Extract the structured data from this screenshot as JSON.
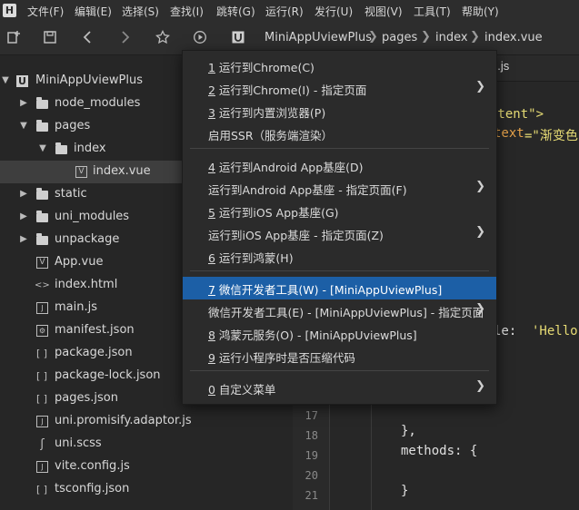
{
  "menubar": {
    "items": [
      "文件(F)",
      "编辑(E)",
      "选择(S)",
      "查找(I)",
      "跳转(G)",
      "运行(R)",
      "发行(U)",
      "视图(V)",
      "工具(T)",
      "帮助(Y)"
    ]
  },
  "breadcrumb": [
    "MiniAppUviewPlus",
    "pages",
    "index",
    "index.vue"
  ],
  "sidebar": {
    "root": "MiniAppUviewPlus",
    "items": [
      {
        "label": "node_modules",
        "type": "folder"
      },
      {
        "label": "pages",
        "type": "folder"
      },
      {
        "label": "index",
        "type": "folder"
      },
      {
        "label": "index.vue",
        "type": "vue"
      },
      {
        "label": "static",
        "type": "folder"
      },
      {
        "label": "uni_modules",
        "type": "folder"
      },
      {
        "label": "unpackage",
        "type": "folder"
      },
      {
        "label": "App.vue",
        "type": "vue"
      },
      {
        "label": "index.html",
        "type": "html"
      },
      {
        "label": "main.js",
        "type": "js"
      },
      {
        "label": "manifest.json",
        "type": "manifest"
      },
      {
        "label": "package.json",
        "type": "json"
      },
      {
        "label": "package-lock.json",
        "type": "json"
      },
      {
        "label": "pages.json",
        "type": "json"
      },
      {
        "label": "uni.promisify.adaptor.js",
        "type": "js"
      },
      {
        "label": "uni.scss",
        "type": "scss"
      },
      {
        "label": "vite.config.js",
        "type": "js"
      },
      {
        "label": "tsconfig.json",
        "type": "json"
      }
    ]
  },
  "editor": {
    "tab_fragment": "g.js",
    "code_fragments": {
      "content": "ntent\">",
      "text_attr": "text",
      "text_value": "=\"渐变色",
      "hello_key": "le: ",
      "hello_val": "'Hello'",
      "brace_comma": "},",
      "methods": "methods: {",
      "close_brace": "}"
    },
    "line_numbers": [
      "17",
      "18",
      "19",
      "20",
      "21"
    ]
  },
  "context_menu": {
    "items": [
      {
        "num": "1",
        "label": " 运行到Chrome(C)",
        "submenu": false
      },
      {
        "num": "2",
        "label": " 运行到Chrome(I) - 指定页面",
        "submenu": true
      },
      {
        "num": "3",
        "label": " 运行到内置浏览器(P)",
        "submenu": false
      },
      {
        "num": "",
        "label": "启用SSR（服务端渲染）",
        "submenu": false
      },
      {
        "num": "4",
        "label": " 运行到Android App基座(D)",
        "submenu": false
      },
      {
        "num": "",
        "label": "运行到Android App基座 - 指定页面(F)",
        "submenu": true
      },
      {
        "num": "5",
        "label": " 运行到iOS App基座(G)",
        "submenu": false
      },
      {
        "num": "",
        "label": "运行到iOS App基座 - 指定页面(Z)",
        "submenu": true
      },
      {
        "num": "6",
        "label": " 运行到鸿蒙(H)",
        "submenu": false
      },
      {
        "num": "7",
        "label": " 微信开发者工具(W) - [MiniAppUviewPlus]",
        "submenu": false,
        "highlighted": true
      },
      {
        "num": "",
        "label": "微信开发者工具(E) - [MiniAppUviewPlus] - 指定页面",
        "submenu": true
      },
      {
        "num": "8",
        "label": " 鸿蒙元服务(O) - [MiniAppUviewPlus]",
        "submenu": false
      },
      {
        "num": "9",
        "label": " 运行小程序时是否压缩代码",
        "submenu": false
      },
      {
        "num": "0",
        "label": " 自定义菜单",
        "submenu": true
      }
    ],
    "submenu_glyph": "❯",
    "highlight_color": "#1c5fa6"
  }
}
